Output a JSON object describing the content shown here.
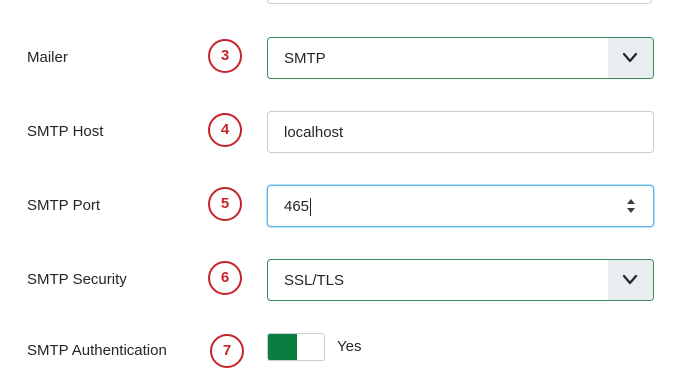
{
  "rows": {
    "mailer": {
      "label": "Mailer",
      "step": "3",
      "value": "SMTP"
    },
    "smtp_host": {
      "label": "SMTP Host",
      "step": "4",
      "value": "localhost"
    },
    "smtp_port": {
      "label": "SMTP Port",
      "step": "5",
      "value": "465"
    },
    "smtp_security": {
      "label": "SMTP Security",
      "step": "6",
      "value": "SSL/TLS"
    },
    "smtp_auth": {
      "label": "SMTP Authentication",
      "step": "7",
      "value": "Yes"
    }
  },
  "icons": {
    "select_arrow": "chevron-down-icon",
    "number_spinner": "spinner-arrows-icon"
  },
  "colors": {
    "step_marker": "#c7242a",
    "toggle_on": "#0a7d41",
    "select_border": "#3b8a5a",
    "focus_border": "#5db7e8"
  }
}
